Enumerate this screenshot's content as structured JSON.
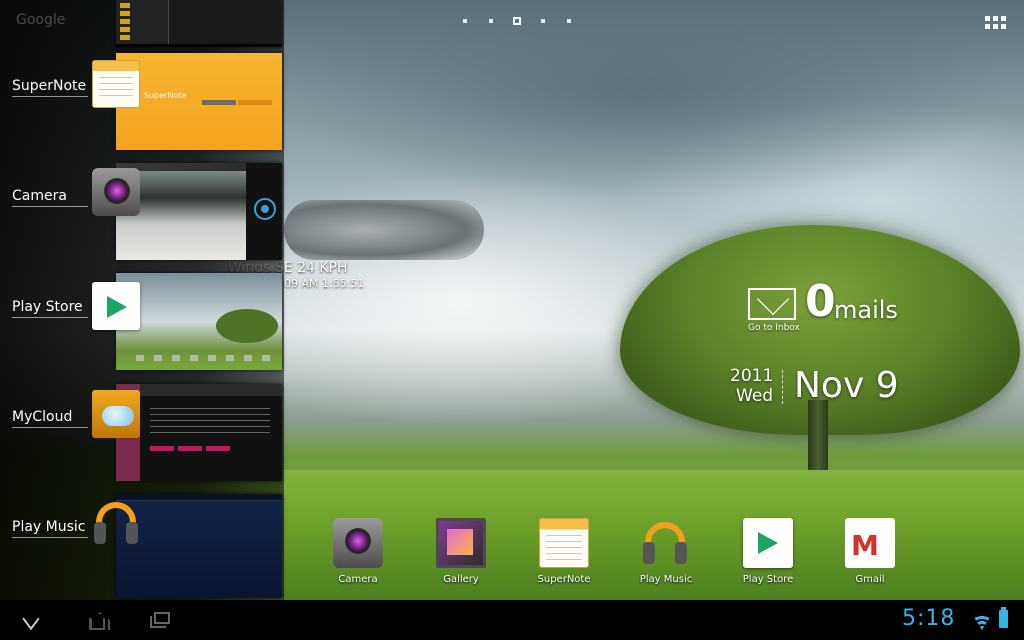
{
  "recents": {
    "ghost_title": "Google",
    "apps": [
      {
        "label": "SuperNote",
        "icon": "supernote-icon"
      },
      {
        "label": "Camera",
        "icon": "camera-icon"
      },
      {
        "label": "Play Store",
        "icon": "play-store-icon"
      },
      {
        "label": "MyCloud",
        "icon": "mycloud-icon"
      },
      {
        "label": "Play Music",
        "icon": "play-music-icon"
      }
    ],
    "supernote_thumb_title": "SuperNote"
  },
  "home": {
    "page_count": 5,
    "active_page": 3,
    "all_apps_icon": "grid-icon"
  },
  "weather": {
    "wind": "Winds SE 24 KPH",
    "updated": "09 AM 1:55:51"
  },
  "email_widget": {
    "count": "0",
    "unit": "mails",
    "goto": "Go to Inbox",
    "icon": "envelope-icon"
  },
  "date_widget": {
    "year": "2011",
    "weekday": "Wed",
    "month_day": "Nov 9"
  },
  "dock": [
    {
      "label": "Camera",
      "icon": "camera-icon"
    },
    {
      "label": "Gallery",
      "icon": "gallery-icon"
    },
    {
      "label": "SuperNote",
      "icon": "supernote-icon"
    },
    {
      "label": "Play Music",
      "icon": "play-music-icon"
    },
    {
      "label": "Play Store",
      "icon": "play-store-icon"
    },
    {
      "label": "Gmail",
      "icon": "gmail-icon"
    }
  ],
  "system_bar": {
    "time": "5:18",
    "accent_color": "#33b5e5"
  }
}
